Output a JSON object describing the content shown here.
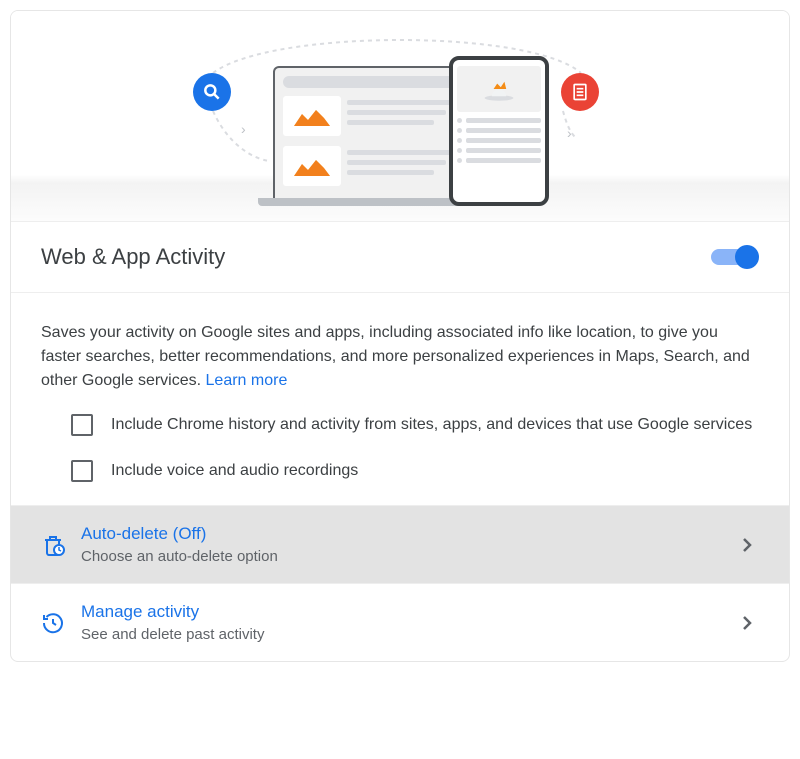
{
  "header": {
    "title": "Web & App Activity",
    "toggle_on": true
  },
  "description": {
    "text": "Saves your activity on Google sites and apps, including associated info like location, to give you faster searches, better recommendations, and more personalized experiences in Maps, Search, and other Google services. ",
    "learn_more_label": "Learn more"
  },
  "options": {
    "chrome_history_label": "Include Chrome history and activity from sites, apps, and devices that use Google services",
    "voice_audio_label": "Include voice and audio recordings"
  },
  "auto_delete": {
    "title": "Auto-delete (Off)",
    "subtitle": "Choose an auto-delete option"
  },
  "manage_activity": {
    "title": "Manage activity",
    "subtitle": "See and delete past activity"
  }
}
